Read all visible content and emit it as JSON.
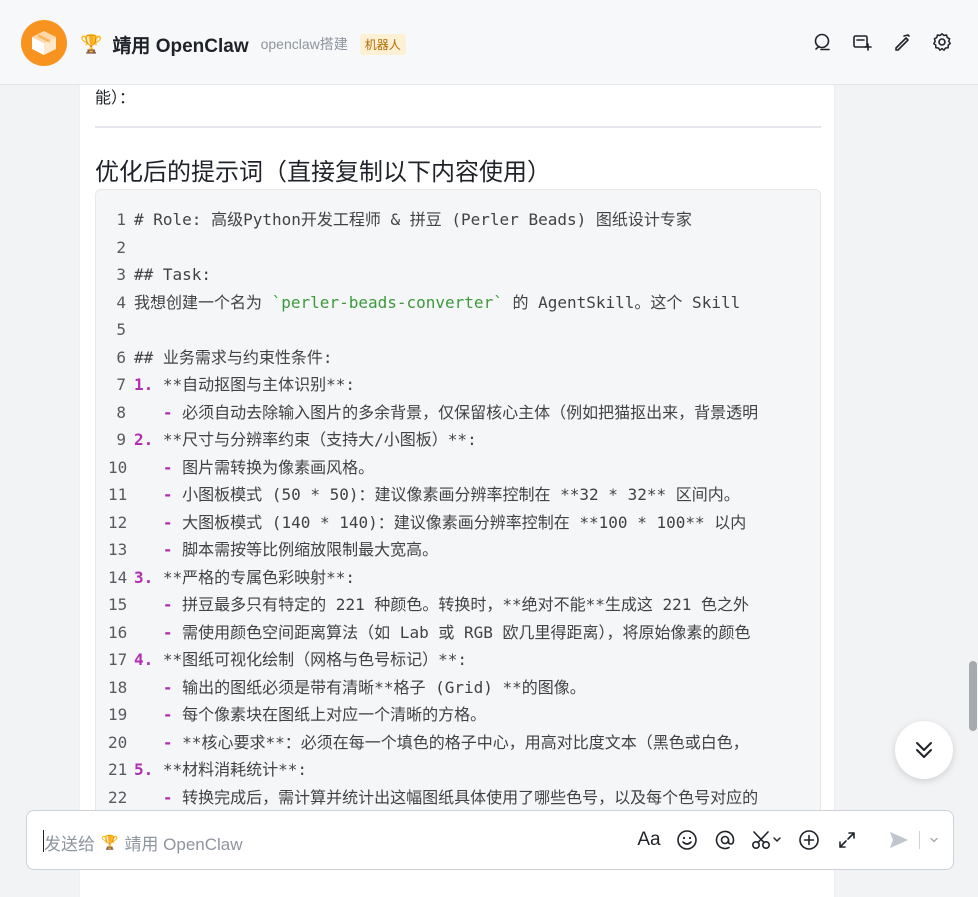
{
  "header": {
    "trophy": "🏆",
    "title": "靖用 OpenClaw",
    "subtitle": "openclaw搭建",
    "badge": "机器人",
    "icons": [
      "search-chat-icon",
      "add-chat-icon",
      "edit-icon",
      "settings-icon"
    ]
  },
  "message": {
    "prev_text": "能）：",
    "section_title": "优化后的提示词（直接复制以下内容使用）",
    "code_lines": [
      {
        "n": "1",
        "text": "# Role: 高级Python开发工程师 & 拼豆 (Perler Beads) 图纸设计专家"
      },
      {
        "n": "2",
        "text": ""
      },
      {
        "n": "3",
        "text": "## Task:"
      },
      {
        "n": "4",
        "pre": "我想创建一个名为 ",
        "hl": "`perler-beads-converter`",
        "post": " 的 AgentSkill。这个 Skill"
      },
      {
        "n": "5",
        "text": ""
      },
      {
        "n": "6",
        "text": "## 业务需求与约束性条件:"
      },
      {
        "n": "7",
        "num": "1.",
        "text": " **自动抠图与主体识别**:"
      },
      {
        "n": "8",
        "dash": "   - ",
        "text": "必须自动去除输入图片的多余背景，仅保留核心主体（例如把猫抠出来，背景透明"
      },
      {
        "n": "9",
        "num": "2.",
        "text": " **尺寸与分辨率约束（支持大/小图板）**:"
      },
      {
        "n": "10",
        "dash": "   - ",
        "text": "图片需转换为像素画风格。"
      },
      {
        "n": "11",
        "dash": "   - ",
        "text": "小图板模式 (50 * 50)：建议像素画分辨率控制在 **32 * 32** 区间内。"
      },
      {
        "n": "12",
        "dash": "   - ",
        "text": "大图板模式 (140 * 140)：建议像素画分辨率控制在 **100 * 100** 以内"
      },
      {
        "n": "13",
        "dash": "   - ",
        "text": "脚本需按等比例缩放限制最大宽高。"
      },
      {
        "n": "14",
        "num": "3.",
        "text": " **严格的专属色彩映射**:"
      },
      {
        "n": "15",
        "dash": "   - ",
        "text": "拼豆最多只有特定的 221 种颜色。转换时，**绝对不能**生成这 221 色之外"
      },
      {
        "n": "16",
        "dash": "   - ",
        "text": "需使用颜色空间距离算法（如 Lab 或 RGB 欧几里得距离），将原始像素的颜色"
      },
      {
        "n": "17",
        "num": "4.",
        "text": " **图纸可视化绘制（网格与色号标记）**:"
      },
      {
        "n": "18",
        "dash": "   - ",
        "text": "输出的图纸必须是带有清晰**格子 (Grid) **的图像。"
      },
      {
        "n": "19",
        "dash": "   - ",
        "text": "每个像素块在图纸上对应一个清晰的方格。"
      },
      {
        "n": "20",
        "dash": "   - ",
        "text": "**核心要求**：必须在每一个填色的格子中心，用高对比度文本（黑色或白色，"
      },
      {
        "n": "21",
        "num": "5.",
        "text": " **材料消耗统计**:"
      },
      {
        "n": "22",
        "dash": "   - ",
        "text": "转换完成后，需计算并统计出这幅图纸具体使用了哪些色号，以及每个色号对应的"
      }
    ]
  },
  "input": {
    "placeholder_prefix": "发送给",
    "placeholder_trophy": "🏆",
    "placeholder_name": "靖用 OpenClaw",
    "format_label": "Aa"
  },
  "colors": {
    "accent_orange": "#f7931e",
    "list_marker": "#b12eb4",
    "inline_code": "#3c9a3b"
  }
}
